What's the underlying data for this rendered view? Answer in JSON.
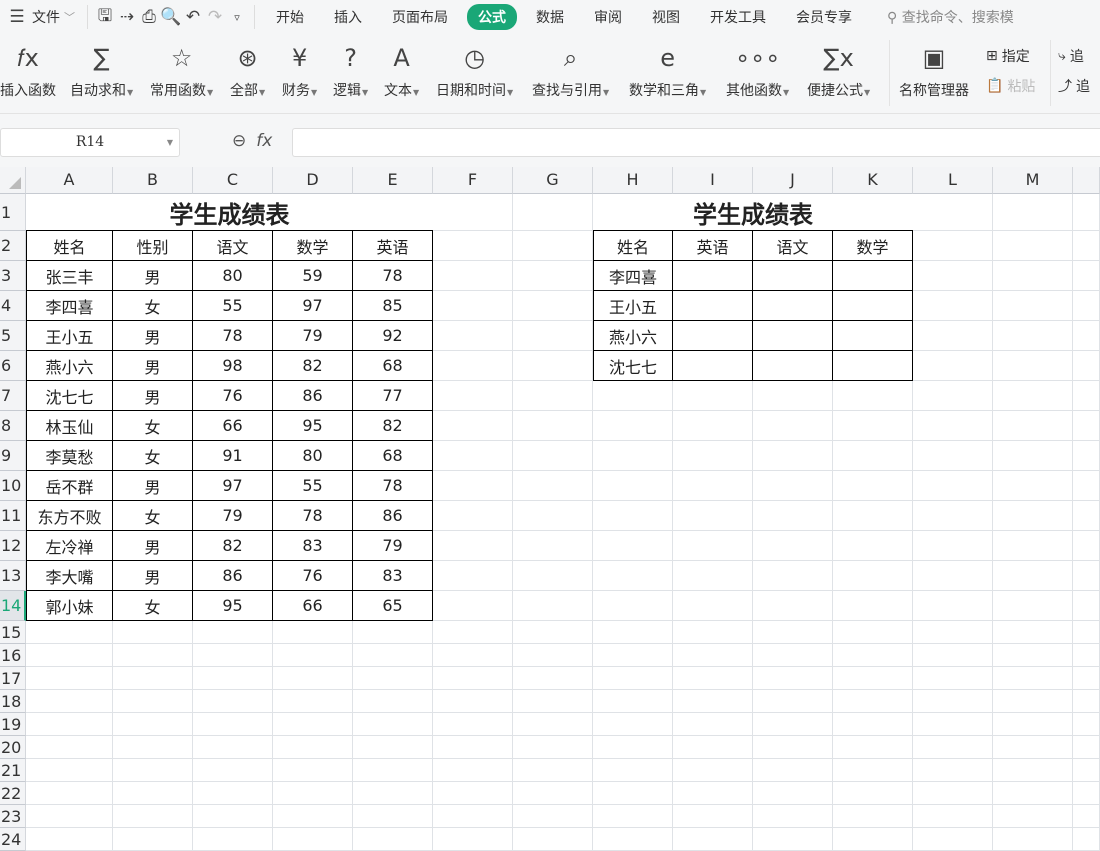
{
  "titlebar": {
    "menu": "文件",
    "tabs": [
      "开始",
      "插入",
      "页面布局",
      "公式",
      "数据",
      "审阅",
      "视图",
      "开发工具",
      "会员专享"
    ],
    "active_tab": "公式",
    "search": "查找命令、搜索模"
  },
  "ribbon": {
    "buttons": [
      {
        "label": "插入函数",
        "icon": "fx-icon",
        "glyph": "𝑓x",
        "dd": false
      },
      {
        "label": "自动求和",
        "icon": "sum-icon",
        "glyph": "∑",
        "dd": true
      },
      {
        "label": "常用函数",
        "icon": "star-icon",
        "glyph": "☆",
        "dd": true
      },
      {
        "label": "全部",
        "icon": "asterisk-icon",
        "glyph": "⊛",
        "dd": true
      },
      {
        "label": "财务",
        "icon": "yen-book-icon",
        "glyph": "¥",
        "dd": true
      },
      {
        "label": "逻辑",
        "icon": "question-book-icon",
        "glyph": "?",
        "dd": true
      },
      {
        "label": "文本",
        "icon": "text-book-icon",
        "glyph": "A",
        "dd": true
      },
      {
        "label": "日期和时间",
        "icon": "clock-book-icon",
        "glyph": "◷",
        "dd": true
      },
      {
        "label": "查找与引用",
        "icon": "search-book-icon",
        "glyph": "⌕",
        "dd": true
      },
      {
        "label": "数学和三角",
        "icon": "e-book-icon",
        "glyph": "e",
        "dd": true
      },
      {
        "label": "其他函数",
        "icon": "more-icon",
        "glyph": "∘∘∘",
        "dd": true
      },
      {
        "label": "便捷公式",
        "icon": "quick-formula-icon",
        "glyph": "∑x",
        "dd": true
      },
      {
        "label": "名称管理器",
        "icon": "name-manager-icon",
        "glyph": "▣",
        "dd": false
      }
    ],
    "assign": "指定",
    "paste": "粘贴",
    "trace1": "追",
    "trace2": "追"
  },
  "formula_bar": {
    "name_box": "R14",
    "formula": ""
  },
  "columns": [
    "A",
    "B",
    "C",
    "D",
    "E",
    "F",
    "G",
    "H",
    "I",
    "J",
    "K",
    "L",
    "M"
  ],
  "rows": [
    "1",
    "2",
    "3",
    "4",
    "5",
    "6",
    "7",
    "8",
    "9",
    "10",
    "11",
    "12",
    "13",
    "14",
    "15",
    "16",
    "17",
    "18",
    "19",
    "20",
    "21",
    "22",
    "23",
    "24"
  ],
  "active_row": "14",
  "table1": {
    "title": "学生成绩表",
    "headers": [
      "姓名",
      "性别",
      "语文",
      "数学",
      "英语"
    ],
    "rows": [
      [
        "张三丰",
        "男",
        "80",
        "59",
        "78"
      ],
      [
        "李四喜",
        "女",
        "55",
        "97",
        "85"
      ],
      [
        "王小五",
        "男",
        "78",
        "79",
        "92"
      ],
      [
        "燕小六",
        "男",
        "98",
        "82",
        "68"
      ],
      [
        "沈七七",
        "男",
        "76",
        "86",
        "77"
      ],
      [
        "林玉仙",
        "女",
        "66",
        "95",
        "82"
      ],
      [
        "李莫愁",
        "女",
        "91",
        "80",
        "68"
      ],
      [
        "岳不群",
        "男",
        "97",
        "55",
        "78"
      ],
      [
        "东方不败",
        "女",
        "79",
        "78",
        "86"
      ],
      [
        "左冷禅",
        "男",
        "82",
        "83",
        "79"
      ],
      [
        "李大嘴",
        "男",
        "86",
        "76",
        "83"
      ],
      [
        "郭小妹",
        "女",
        "95",
        "66",
        "65"
      ]
    ]
  },
  "table2": {
    "title": "学生成绩表",
    "headers": [
      "姓名",
      "英语",
      "语文",
      "数学"
    ],
    "rows": [
      [
        "李四喜",
        "",
        "",
        ""
      ],
      [
        "王小五",
        "",
        "",
        ""
      ],
      [
        "燕小六",
        "",
        "",
        ""
      ],
      [
        "沈七七",
        "",
        "",
        ""
      ]
    ]
  }
}
